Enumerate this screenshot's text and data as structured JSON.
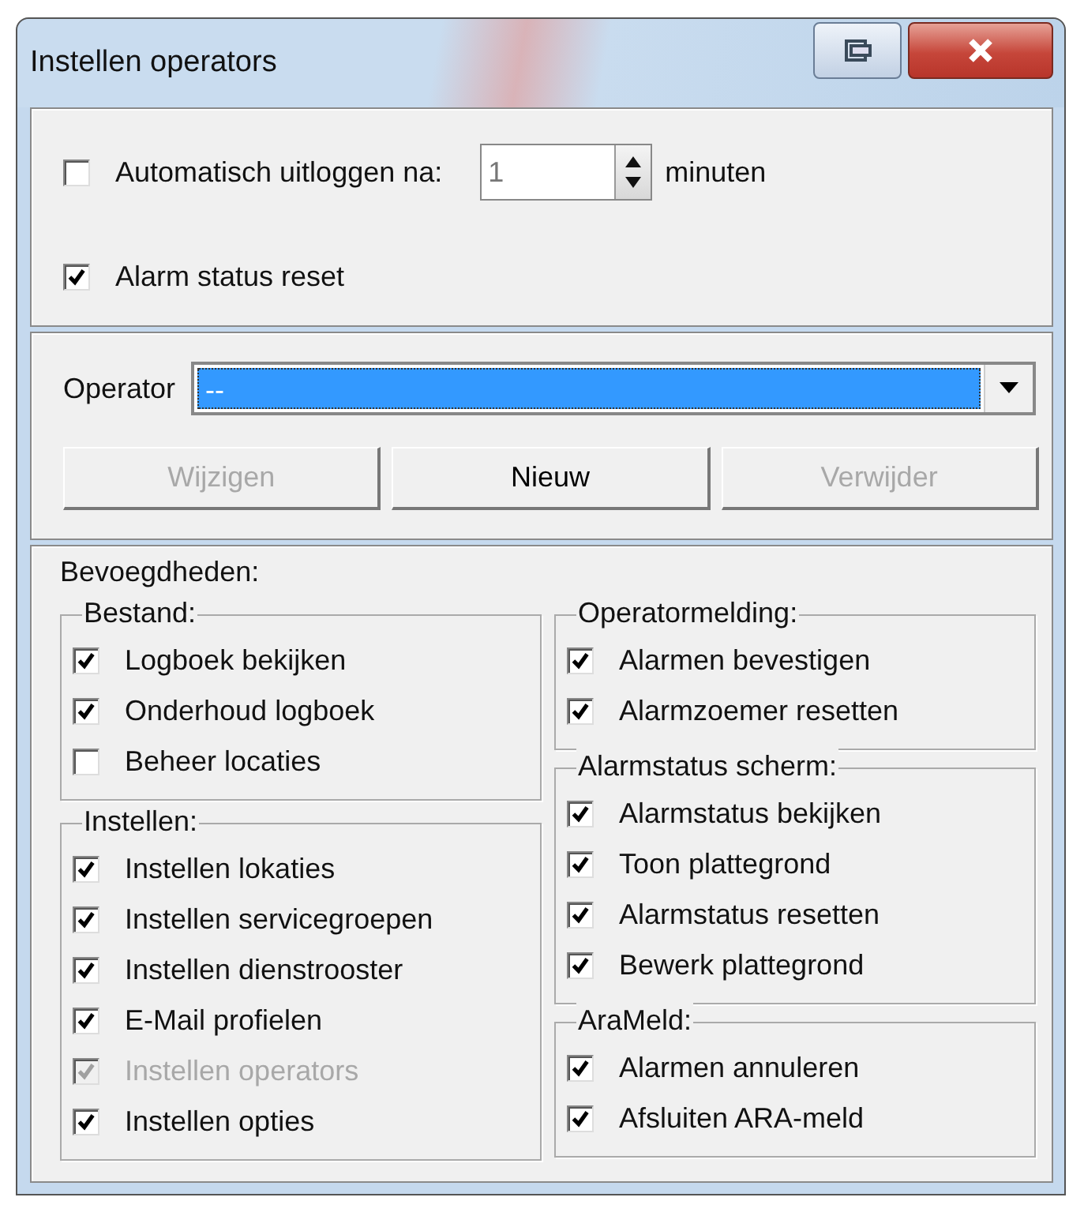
{
  "window": {
    "title": "Instellen operators"
  },
  "auto_logout": {
    "label": "Automatisch uitloggen na:",
    "checked": false,
    "value": "1",
    "unit": "minuten"
  },
  "alarm_status_reset": {
    "label": "Alarm status reset",
    "checked": true
  },
  "operator": {
    "label": "Operator",
    "value": "--"
  },
  "buttons": [
    {
      "label": "Wijzigen",
      "disabled": true
    },
    {
      "label": "Nieuw",
      "disabled": false
    },
    {
      "label": "Verwijder",
      "disabled": true
    }
  ],
  "permissions": {
    "title": "Bevoegdheden:",
    "columns": [
      [
        {
          "title": "Bestand:",
          "items": [
            {
              "label": "Logboek bekijken",
              "checked": true,
              "disabled": false
            },
            {
              "label": "Onderhoud logboek",
              "checked": true,
              "disabled": false
            },
            {
              "label": "Beheer locaties",
              "checked": false,
              "disabled": false
            }
          ]
        },
        {
          "title": "Instellen:",
          "items": [
            {
              "label": "Instellen lokaties",
              "checked": true,
              "disabled": false
            },
            {
              "label": "Instellen servicegroepen",
              "checked": true,
              "disabled": false
            },
            {
              "label": "Instellen dienstrooster",
              "checked": true,
              "disabled": false
            },
            {
              "label": "E-Mail profielen",
              "checked": true,
              "disabled": false
            },
            {
              "label": "Instellen operators",
              "checked": true,
              "disabled": true
            },
            {
              "label": "Instellen opties",
              "checked": true,
              "disabled": false
            }
          ]
        }
      ],
      [
        {
          "title": "Operatormelding:",
          "items": [
            {
              "label": "Alarmen bevestigen",
              "checked": true,
              "disabled": false
            },
            {
              "label": "Alarmzoemer resetten",
              "checked": true,
              "disabled": false
            }
          ]
        },
        {
          "title": "Alarmstatus scherm:",
          "items": [
            {
              "label": "Alarmstatus bekijken",
              "checked": true,
              "disabled": false
            },
            {
              "label": "Toon plattegrond",
              "checked": true,
              "disabled": false
            },
            {
              "label": "Alarmstatus resetten",
              "checked": true,
              "disabled": false
            },
            {
              "label": "Bewerk plattegrond",
              "checked": true,
              "disabled": false
            }
          ]
        },
        {
          "title": "AraMeld:",
          "items": [
            {
              "label": "Alarmen annuleren",
              "checked": true,
              "disabled": false
            },
            {
              "label": "Afsluiten ARA-meld",
              "checked": true,
              "disabled": false
            }
          ]
        }
      ]
    ]
  }
}
